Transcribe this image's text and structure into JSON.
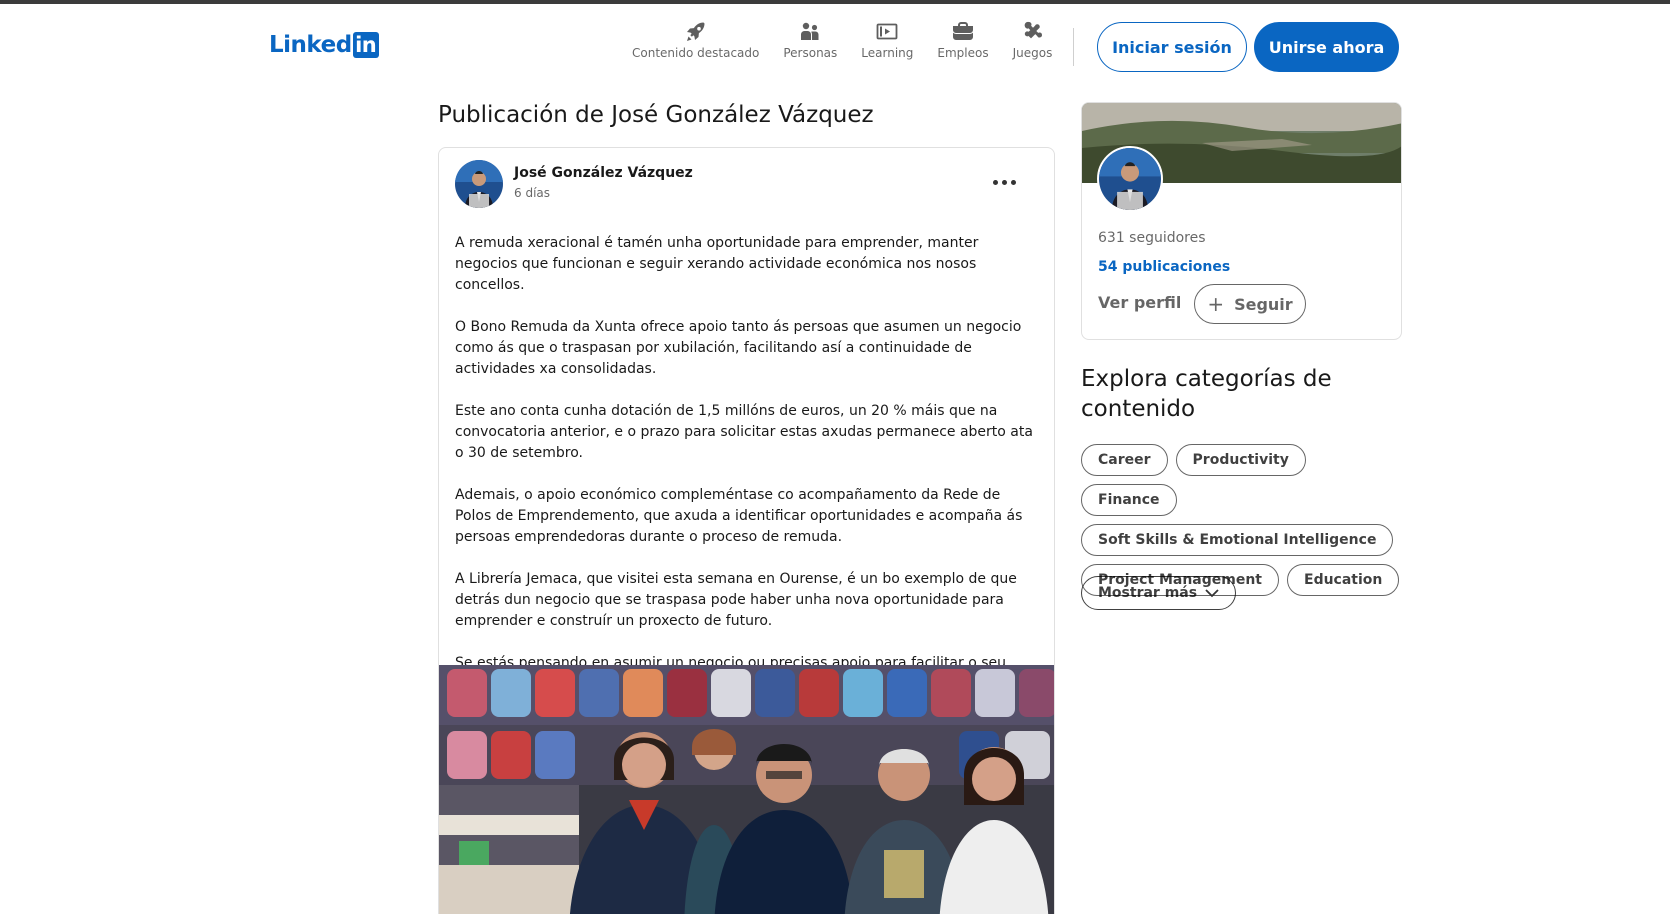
{
  "header": {
    "logo_text": "Linked",
    "logo_in": "in",
    "nav": [
      {
        "label": "Contenido destacado",
        "icon": "rocket-icon"
      },
      {
        "label": "Personas",
        "icon": "people-icon"
      },
      {
        "label": "Learning",
        "icon": "play-video-icon"
      },
      {
        "label": "Empleos",
        "icon": "briefcase-icon"
      },
      {
        "label": "Juegos",
        "icon": "puzzle-icon"
      }
    ],
    "signin_label": "Iniciar sesión",
    "join_label": "Unirse ahora"
  },
  "main": {
    "page_title": "Publicación de José González Vázquez",
    "post": {
      "author": "José González Vázquez",
      "time": "6 días",
      "paragraphs": [
        "A remuda xeracional é tamén unha oportunidade para emprender, manter negocios que funcionan e seguir xerando actividade económica nos nosos concellos.",
        "O Bono Remuda da Xunta ofrece apoio tanto ás persoas que asumen un negocio como ás que o traspasan por xubilación, facilitando así a continuidade de actividades xa consolidadas.",
        "Este ano conta cunha dotación de 1,5 millóns de euros, un 20 % máis que na convocatoria anterior, e o prazo para solicitar estas axudas permanece aberto ata o 30 de setembro.",
        "Ademais, o apoio económico compleméntase co acompañamento da Rede de Polos de Emprendemento, que axuda a identificar oportunidades e acompaña ás persoas emprendedoras durante o proceso de remuda.",
        "A Librería Jemaca, que visitei esta semana en Ourense, é un bo exemplo de que detrás dun negocio que se traspasa pode haber unha nova oportunidade para emprender e construír un proxecto de futuro.",
        "Se estás pensando en asumir un negocio ou precisas apoio para facilitar o seu traspaso, aínda estás a tempo de solicitar o Bono Remuda."
      ],
      "more_icon": "ellipsis-icon"
    }
  },
  "sidebar": {
    "followers": "631 seguidores",
    "posts": "54 publicaciones",
    "view_profile": "Ver perfil",
    "follow_label": "Seguir",
    "explore_title": "Explora categorías de contenido",
    "categories": [
      "Career",
      "Productivity",
      "Finance",
      "Soft Skills & Emotional Intelligence",
      "Project Management",
      "Education"
    ],
    "show_more": "Mostrar más"
  },
  "colors": {
    "brand": "#0a66c2",
    "text": "#191919",
    "muted": "#666666",
    "border": "#e0e0e0"
  }
}
